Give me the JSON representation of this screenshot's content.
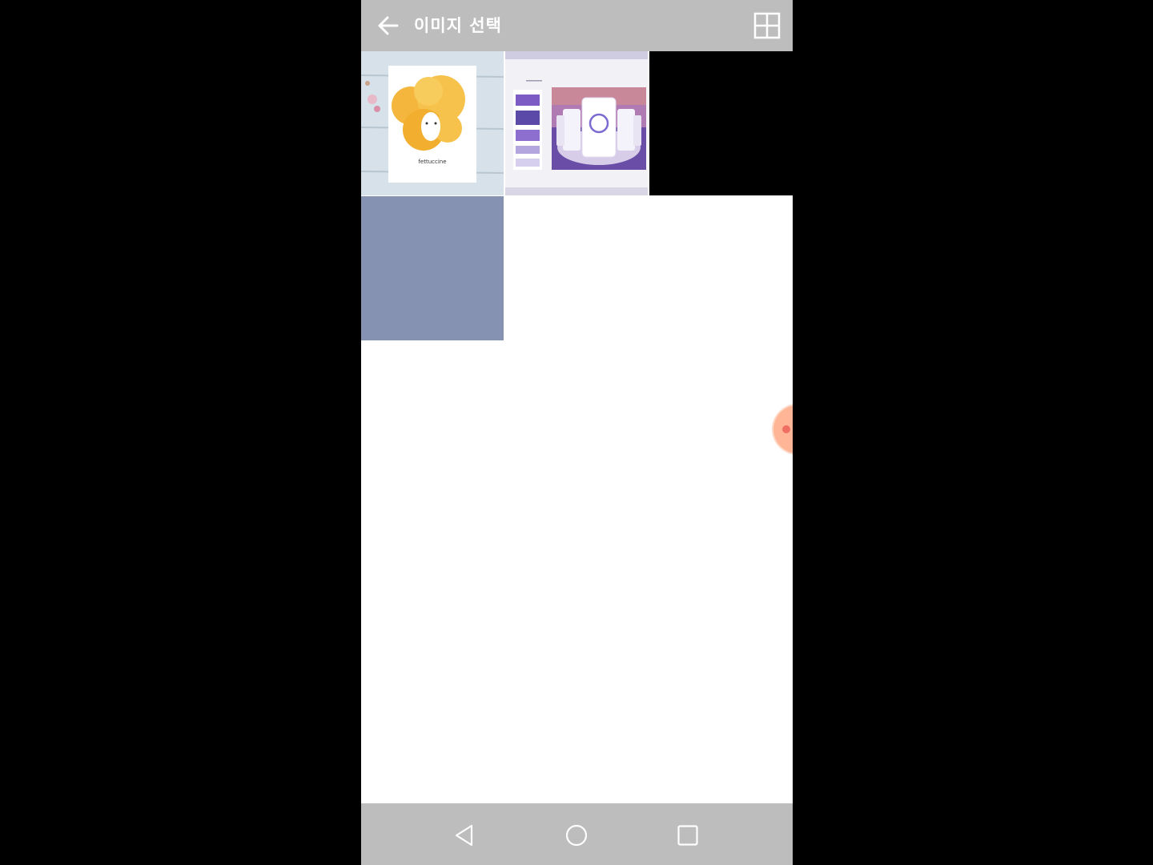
{
  "app": {
    "title": "이미지 선택"
  },
  "toolbar": {
    "back_icon": "arrow-left-icon",
    "layout_icon": "grid-layout-icon"
  },
  "gallery": {
    "items": [
      {
        "kind": "photo",
        "description_label": "fettuccine",
        "caption": "fettuccine"
      },
      {
        "kind": "photo",
        "description_label": "app-mockup"
      },
      {
        "kind": "color",
        "color": "#8592b2"
      }
    ]
  },
  "fab": {
    "icon": "floating-bubble-icon",
    "color": "#ffb596",
    "dot_color": "#ef6f62"
  },
  "system_nav": {
    "back_icon": "nav-back-triangle-icon",
    "home_icon": "nav-home-circle-icon",
    "recents_icon": "nav-recents-square-icon"
  },
  "colors": {
    "appbar": "#bdbdbd",
    "background": "#ffffff",
    "outer": "#000000"
  }
}
